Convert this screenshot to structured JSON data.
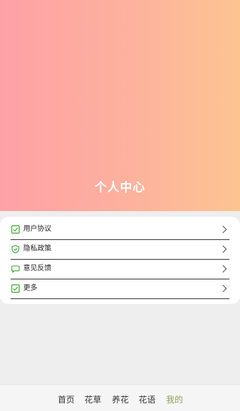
{
  "header": {
    "title": "个人中心"
  },
  "menu": {
    "items": [
      {
        "label": "用户协议",
        "icon": "checkbox-icon"
      },
      {
        "label": "隐私政策",
        "icon": "shield-check-icon"
      },
      {
        "label": "意见反馈",
        "icon": "message-icon"
      },
      {
        "label": "更多",
        "icon": "checkbox-icon"
      }
    ],
    "icon_color": "#3aa52f"
  },
  "tabbar": {
    "tabs": [
      {
        "label": "首页",
        "active": false
      },
      {
        "label": "花草",
        "active": false
      },
      {
        "label": "养花",
        "active": false
      },
      {
        "label": "花语",
        "active": false
      },
      {
        "label": "我的",
        "active": true
      }
    ],
    "active_color": "#8aa25a"
  },
  "colors": {
    "hero_gradient_start": "#fea1a6",
    "hero_gradient_end": "#fdc492",
    "page_background": "#eeeeee"
  }
}
